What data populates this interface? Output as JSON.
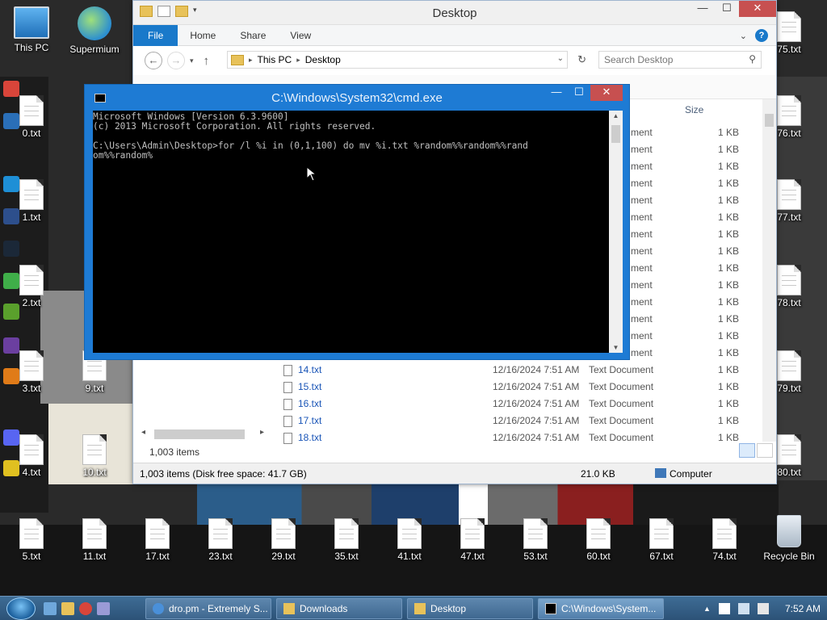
{
  "desktop": {
    "top_icons": [
      {
        "label": "This PC",
        "icon": "computer-icon"
      },
      {
        "label": "Supermium",
        "icon": "browser-globe-icon"
      }
    ],
    "left_files": [
      "0.txt",
      "1.txt",
      "2.txt",
      "3.txt",
      "4.txt"
    ],
    "mid_files": [
      "9.txt",
      "10.txt"
    ],
    "right_files": [
      "75.txt",
      "76.txt",
      "77.txt",
      "78.txt",
      "79.txt",
      "80.txt"
    ],
    "bottom_files": [
      "5.txt",
      "11.txt",
      "17.txt",
      "23.txt",
      "29.txt",
      "35.txt",
      "41.txt",
      "47.txt",
      "53.txt",
      "60.txt",
      "67.txt",
      "74.txt"
    ],
    "recycle_bin": "Recycle Bin"
  },
  "explorer": {
    "title": "Desktop",
    "ribbon_tabs": {
      "file": "File",
      "home": "Home",
      "share": "Share",
      "view": "View"
    },
    "address": {
      "root": "This PC",
      "current": "Desktop"
    },
    "search_placeholder": "Search Desktop",
    "column_size": "Size",
    "partial_type": "ment",
    "rows": [
      {
        "name": "14.txt",
        "date": "12/16/2024 7:51 AM",
        "type": "Text Document",
        "size": "1 KB"
      },
      {
        "name": "15.txt",
        "date": "12/16/2024 7:51 AM",
        "type": "Text Document",
        "size": "1 KB"
      },
      {
        "name": "16.txt",
        "date": "12/16/2024 7:51 AM",
        "type": "Text Document",
        "size": "1 KB"
      },
      {
        "name": "17.txt",
        "date": "12/16/2024 7:51 AM",
        "type": "Text Document",
        "size": "1 KB"
      },
      {
        "name": "18.txt",
        "date": "12/16/2024 7:51 AM",
        "type": "Text Document",
        "size": "1 KB"
      }
    ],
    "size_column_values": "1 KB",
    "items_count": "1,003 items",
    "status_left": "1,003 items (Disk free space: 41.7 GB)",
    "status_size": "21.0 KB",
    "status_location": "Computer"
  },
  "cmd": {
    "title": "C:\\Windows\\System32\\cmd.exe",
    "console_text": "Microsoft Windows [Version 6.3.9600]\n(c) 2013 Microsoft Corporation. All rights reserved.\n\nC:\\Users\\Admin\\Desktop>for /l %i in (0,1,100) do mv %i.txt %random%%random%%rand\nom%%random%"
  },
  "taskbar": {
    "tasks": [
      {
        "label": "dro.pm - Extremely S...",
        "icon": "browser-icon"
      },
      {
        "label": "Downloads",
        "icon": "folder-icon"
      },
      {
        "label": "Desktop",
        "icon": "folder-icon"
      },
      {
        "label": "C:\\Windows\\System...",
        "icon": "cmd-icon"
      }
    ],
    "clock": "7:52 AM"
  },
  "colors": {
    "accent": "#1979ca",
    "cmd_frame": "#1e7bd4",
    "close_red": "#c75050",
    "taskbar": "#2c5277"
  }
}
